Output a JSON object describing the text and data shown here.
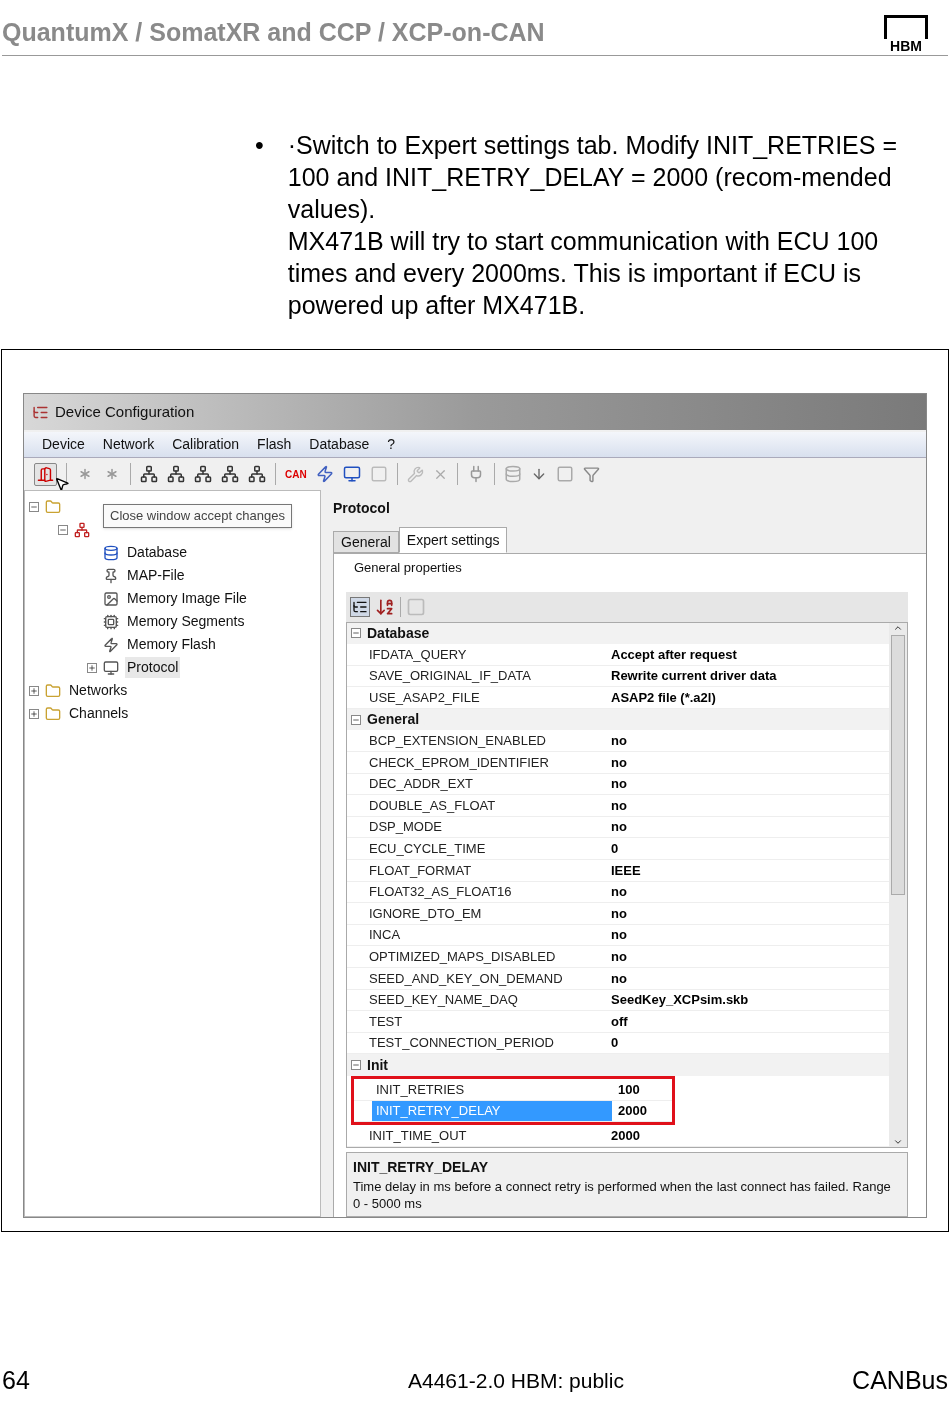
{
  "header": {
    "title": "QuantumX / SomatXR and CCP / XCP-on-CAN",
    "logo": "HBM"
  },
  "bullet": {
    "marker": "•",
    "paragraphs": [
      "·Switch to Expert settings tab. Modify INIT_RETRIES = 100 and INIT_RETRY_DELAY = 2000 (recom-mended values).",
      "MX471B will try to start communication with ECU 100 times and every 2000ms. This is important if ECU is powered up after MX471B."
    ]
  },
  "window": {
    "title": "Device Configuration",
    "menu": [
      "Device",
      "Network",
      "Calibration",
      "Flash",
      "Database",
      "?"
    ],
    "toolbar": {
      "can_label": "CAN"
    },
    "tooltip": "Close window accept changes",
    "tree": [
      {
        "kind": "folder",
        "expanded": true,
        "children": [
          {
            "kind": "ecu",
            "expanded": true,
            "children": [
              {
                "label": "Database",
                "kind": "db"
              },
              {
                "label": "MAP-File",
                "kind": "pin"
              },
              {
                "label": "Memory Image File",
                "kind": "image"
              },
              {
                "label": "Memory Segments",
                "kind": "chip"
              },
              {
                "label": "Memory Flash",
                "kind": "flash"
              },
              {
                "label": "Protocol",
                "kind": "protocol",
                "expanded": false,
                "selected": true
              }
            ]
          }
        ]
      },
      {
        "label": "Networks",
        "kind": "folder",
        "expanded": false
      },
      {
        "label": "Channels",
        "kind": "folder",
        "expanded": false
      }
    ],
    "panel_title": "Protocol",
    "tabs": [
      {
        "label": "General",
        "selected": false
      },
      {
        "label": "Expert settings",
        "selected": true
      }
    ],
    "group_title": "General properties",
    "grid": [
      {
        "category": "Database",
        "expanded": true,
        "rows": [
          {
            "name": "IFDATA_QUERY",
            "value": "Accept after request"
          },
          {
            "name": "SAVE_ORIGINAL_IF_DATA",
            "value": "Rewrite current driver data"
          },
          {
            "name": "USE_ASAP2_FILE",
            "value": "ASAP2 file (*.a2l)"
          }
        ]
      },
      {
        "category": "General",
        "expanded": true,
        "rows": [
          {
            "name": "BCP_EXTENSION_ENABLED",
            "value": "no"
          },
          {
            "name": "CHECK_EPROM_IDENTIFIER",
            "value": "no"
          },
          {
            "name": "DEC_ADDR_EXT",
            "value": "no"
          },
          {
            "name": "DOUBLE_AS_FLOAT",
            "value": "no"
          },
          {
            "name": "DSP_MODE",
            "value": "no"
          },
          {
            "name": "ECU_CYCLE_TIME",
            "value": "0"
          },
          {
            "name": "FLOAT_FORMAT",
            "value": "IEEE"
          },
          {
            "name": "FLOAT32_AS_FLOAT16",
            "value": "no"
          },
          {
            "name": "IGNORE_DTO_EM",
            "value": "no"
          },
          {
            "name": "INCA",
            "value": "no"
          },
          {
            "name": "OPTIMIZED_MAPS_DISABLED",
            "value": "no"
          },
          {
            "name": "SEED_AND_KEY_ON_DEMAND",
            "value": "no"
          },
          {
            "name": "SEED_KEY_NAME_DAQ",
            "value": "SeedKey_XCPsim.skb"
          },
          {
            "name": "TEST",
            "value": "off"
          },
          {
            "name": "TEST_CONNECTION_PERIOD",
            "value": "0"
          }
        ]
      },
      {
        "category": "Init",
        "expanded": true,
        "rows": [
          {
            "name": "INIT_RETRIES",
            "value": "100",
            "selected": false,
            "highlighted": true
          },
          {
            "name": "INIT_RETRY_DELAY",
            "value": "2000",
            "selected": true,
            "highlighted": true
          },
          {
            "name": "INIT_TIME_OUT",
            "value": "2000",
            "selected": false
          }
        ]
      }
    ],
    "description": {
      "title": "INIT_RETRY_DELAY",
      "text": "Time delay in ms before a connect retry is performed when the last connect has failed. Range 0 -  5000 ms"
    }
  },
  "footer": {
    "page": "64",
    "doc": "A4461-2.0  HBM: public",
    "section": "CANBus"
  }
}
